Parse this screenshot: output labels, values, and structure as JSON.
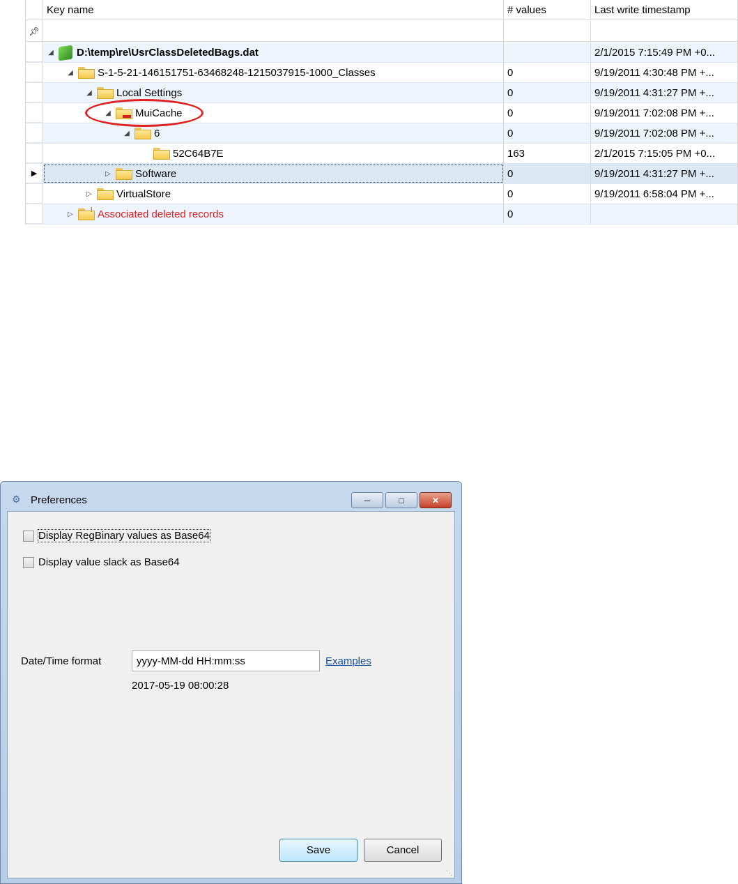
{
  "grid": {
    "columns": {
      "key": "Key name",
      "values": "# values",
      "timestamp": "Last write timestamp"
    },
    "filter_icon": "pin-icon",
    "rows": [
      {
        "label": "D:\\temp\\re\\UsrClassDeletedBags.dat",
        "values": "",
        "timestamp": "2/1/2015 7:15:49 PM +0...",
        "expander": "expanded",
        "icon": "hive-icon"
      },
      {
        "label": "S-1-5-21-146151751-63468248-1215037915-1000_Classes",
        "values": "0",
        "timestamp": "9/19/2011 4:30:48 PM +...",
        "expander": "expanded",
        "icon": "folder-icon"
      },
      {
        "label": "Local Settings",
        "values": "0",
        "timestamp": "9/19/2011 4:31:27 PM +...",
        "expander": "expanded",
        "icon": "folder-icon"
      },
      {
        "label": "MuiCache",
        "values": "0",
        "timestamp": "9/19/2011 7:02:08 PM +...",
        "expander": "expanded",
        "icon": "deleted-folder-icon"
      },
      {
        "label": "6",
        "values": "0",
        "timestamp": "9/19/2011 7:02:08 PM +...",
        "expander": "expanded",
        "icon": "folder-icon"
      },
      {
        "label": "52C64B7E",
        "values": "163",
        "timestamp": "2/1/2015 7:15:05 PM +0...",
        "expander": "none",
        "icon": "folder-icon"
      },
      {
        "label": "Software",
        "values": "0",
        "timestamp": "9/19/2011 4:31:27 PM +...",
        "expander": "collapsed",
        "icon": "folder-icon"
      },
      {
        "label": "VirtualStore",
        "values": "0",
        "timestamp": "9/19/2011 6:58:04 PM +...",
        "expander": "collapsed",
        "icon": "folder-icon"
      },
      {
        "label": "Associated deleted records",
        "values": "0",
        "timestamp": "",
        "expander": "collapsed",
        "icon": "warning-folder-icon"
      }
    ],
    "highlight_color": "#e02020"
  },
  "dialog": {
    "title": "Preferences",
    "title_icon": "gears-icon",
    "checkboxes": [
      {
        "label": "Display RegBinary values as Base64",
        "checked": false
      },
      {
        "label": "Display value slack as Base64",
        "checked": false
      }
    ],
    "datetime": {
      "label": "Date/Time format",
      "value": "yyyy-MM-dd HH:mm:ss",
      "link": "Examples",
      "preview": "2017-05-19 08:00:28"
    },
    "buttons": {
      "save": "Save",
      "cancel": "Cancel"
    }
  }
}
